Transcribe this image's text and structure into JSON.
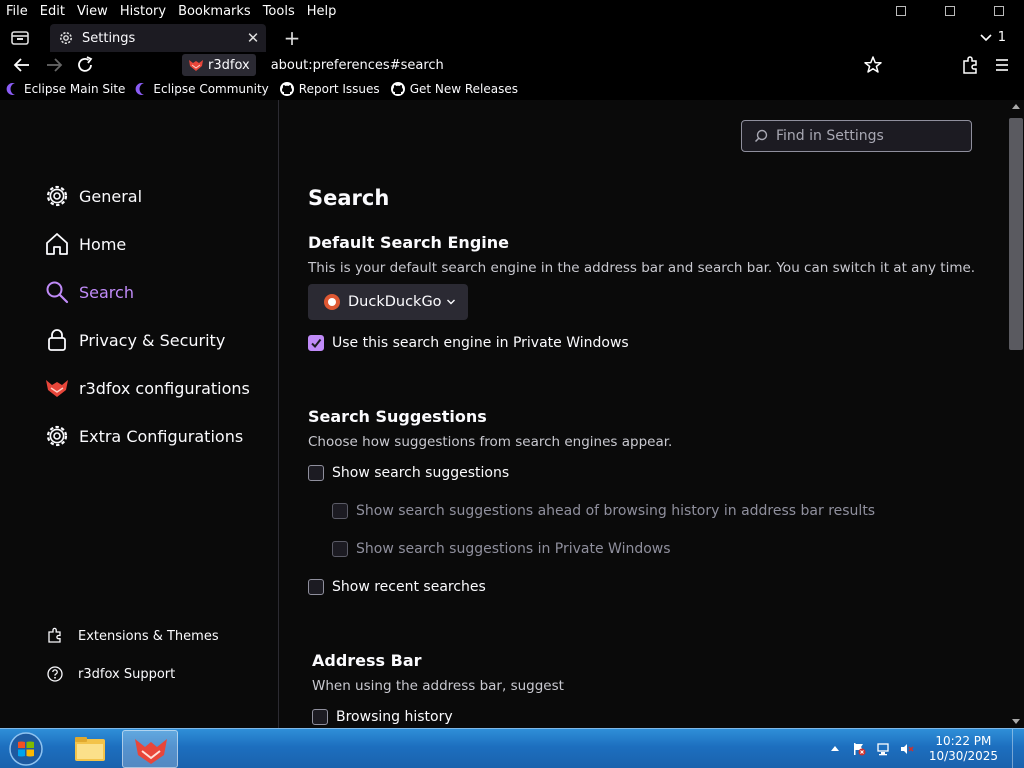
{
  "menubar": {
    "items": [
      "File",
      "Edit",
      "View",
      "History",
      "Bookmarks",
      "Tools",
      "Help"
    ]
  },
  "tabs": {
    "active_title": "Settings",
    "overflow_count": "1"
  },
  "navbar": {
    "identity_label": "r3dfox",
    "url": "about:preferences#search"
  },
  "bookmarks": {
    "items": [
      {
        "label": "Eclipse Main Site",
        "icon": "eclipse-icon"
      },
      {
        "label": "Eclipse Community",
        "icon": "eclipse-icon"
      },
      {
        "label": "Report Issues",
        "icon": "github-icon"
      },
      {
        "label": "Get New Releases",
        "icon": "github-icon"
      }
    ]
  },
  "find": {
    "placeholder": "Find in Settings"
  },
  "sidebar": {
    "categories": [
      {
        "label": "General",
        "icon": "gear-icon"
      },
      {
        "label": "Home",
        "icon": "home-icon"
      },
      {
        "label": "Search",
        "icon": "search-icon",
        "selected": true
      },
      {
        "label": "Privacy & Security",
        "icon": "lock-icon"
      },
      {
        "label": "r3dfox configurations",
        "icon": "r3dfox-icon"
      },
      {
        "label": "Extra Configurations",
        "icon": "gear-icon"
      }
    ],
    "footer": [
      {
        "label": "Extensions & Themes",
        "icon": "puzzle-icon"
      },
      {
        "label": "r3dfox Support",
        "icon": "help-icon"
      }
    ]
  },
  "main": {
    "title": "Search",
    "default_engine": {
      "heading": "Default Search Engine",
      "description": "This is your default search engine in the address bar and search bar. You can switch it at any time.",
      "selected_engine": "DuckDuckGo",
      "private_checkbox": {
        "label": "Use this search engine in Private Windows",
        "checked": true
      }
    },
    "suggestions": {
      "heading": "Search Suggestions",
      "description": "Choose how suggestions from search engines appear.",
      "show_suggestions": {
        "label": "Show search suggestions",
        "checked": false
      },
      "ahead_of_history": {
        "label": "Show search suggestions ahead of browsing history in address bar results",
        "checked": false
      },
      "private_windows": {
        "label": "Show search suggestions in Private Windows",
        "checked": false
      },
      "recent_searches": {
        "label": "Show recent searches",
        "checked": false
      }
    },
    "address_bar": {
      "heading": "Address Bar",
      "description": "When using the address bar, suggest",
      "browsing_history": {
        "label": "Browsing history",
        "checked": false
      }
    }
  },
  "taskbar": {
    "time": "10:22 PM",
    "date": "10/30/2025"
  },
  "colors": {
    "accent": "#c08bf8",
    "page_bg": "#0a0a0a",
    "taskbar": "#1d6fbf"
  }
}
